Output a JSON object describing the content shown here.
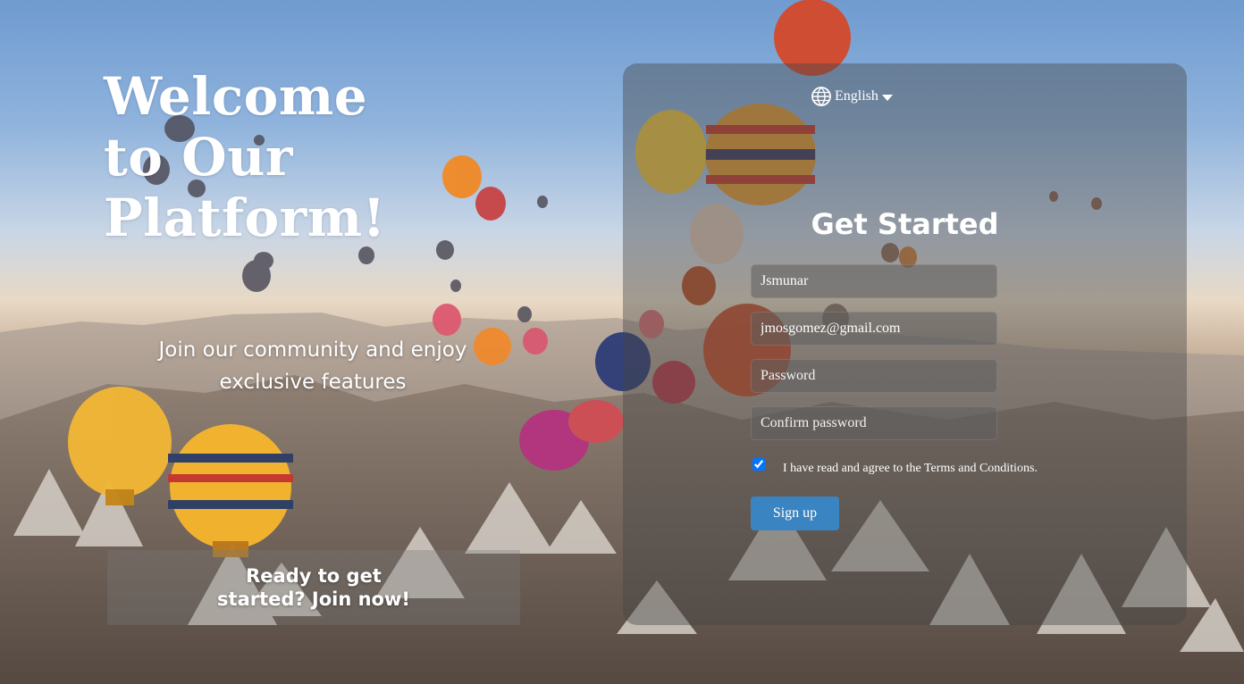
{
  "hero": {
    "title": "Welcome\nto Our\nPlatform!",
    "subtitle": "Join our community and enjoy exclusive features",
    "cta": "Ready to get started? Join now!"
  },
  "signup": {
    "language": "English",
    "title": "Get Started",
    "fields": {
      "username_value": "Jsmunar",
      "email_value": "jmosgomez@gmail.com",
      "password_placeholder": "Password",
      "confirm_placeholder": "Confirm password"
    },
    "terms": {
      "label": "I have read and agree to the Terms and Conditions.",
      "checked": true
    },
    "submit_label": "Sign up"
  }
}
